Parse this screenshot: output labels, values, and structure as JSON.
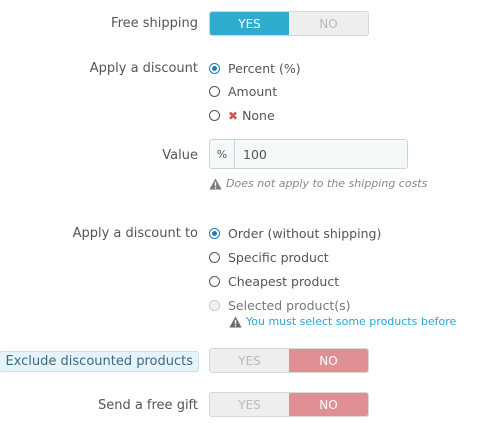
{
  "free_shipping": {
    "label": "Free shipping",
    "yes": "YES",
    "no": "NO",
    "selected": "yes"
  },
  "apply_discount": {
    "label": "Apply a discount",
    "options": [
      {
        "label": "Percent (%)",
        "checked": true
      },
      {
        "label": "Amount",
        "checked": false
      },
      {
        "label": "None",
        "checked": false,
        "icon": "x-icon"
      }
    ]
  },
  "value": {
    "label": "Value",
    "addon": "%",
    "value": "100",
    "help": "Does not apply to the shipping costs",
    "help_icon": "warning-icon"
  },
  "apply_to": {
    "label": "Apply a discount to",
    "options": [
      {
        "label": "Order (without shipping)",
        "checked": true
      },
      {
        "label": "Specific product",
        "checked": false
      },
      {
        "label": "Cheapest product",
        "checked": false
      },
      {
        "label": "Selected product(s)",
        "checked": false,
        "disabled": true
      }
    ],
    "warning": "You must select some products before",
    "warning_icon": "warning-icon"
  },
  "exclude_discounted": {
    "label": "Exclude discounted products",
    "yes": "YES",
    "no": "NO",
    "selected": "no"
  },
  "free_gift": {
    "label": "Send a free gift",
    "yes": "YES",
    "no": "NO",
    "selected": "no"
  },
  "colors": {
    "accent_yes": "#2eacce",
    "accent_no": "#e08f95",
    "radio_checked": "#1e7fb8",
    "warning_text": "#25a7d9"
  }
}
